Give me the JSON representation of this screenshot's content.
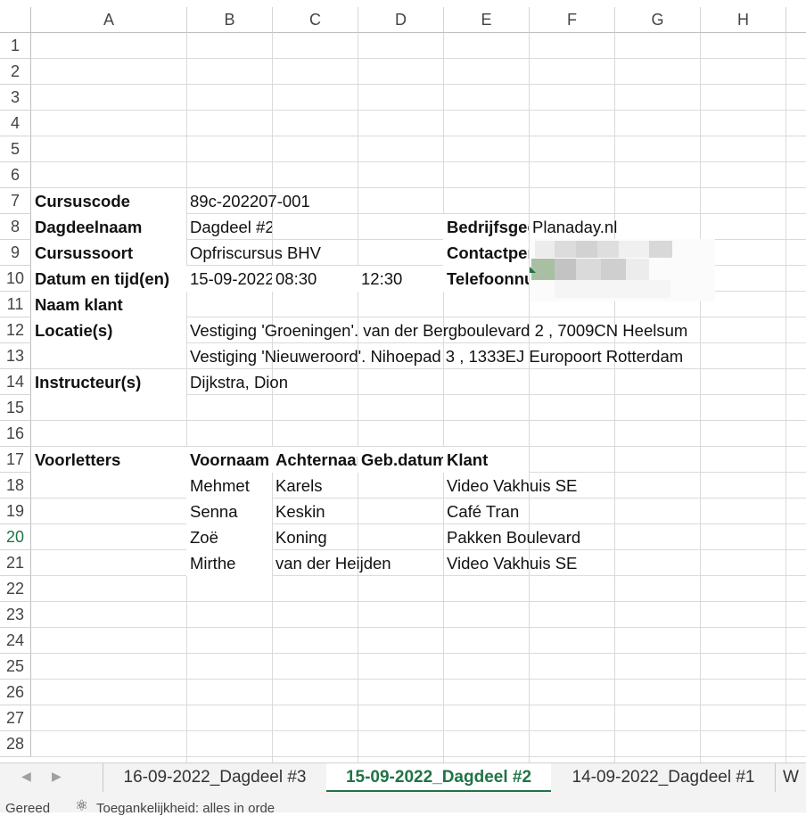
{
  "columns": [
    "A",
    "B",
    "C",
    "D",
    "E",
    "F",
    "G",
    "H"
  ],
  "rows": [
    "1",
    "2",
    "3",
    "4",
    "5",
    "6",
    "7",
    "8",
    "9",
    "10",
    "11",
    "12",
    "13",
    "14",
    "15",
    "16",
    "17",
    "18",
    "19",
    "20",
    "21",
    "22",
    "23",
    "24",
    "25",
    "26",
    "27",
    "28"
  ],
  "active_row": "20",
  "info": {
    "cursuscode_label": "Cursuscode",
    "cursuscode_value": "89c-202207-001",
    "dagdeelnaam_label": "Dagdeelnaam",
    "dagdeelnaam_value": "Dagdeel #2",
    "cursussoort_label": "Cursussoort",
    "cursussoort_value": "Opfriscursus BHV",
    "datum_label": "Datum en tijd(en)",
    "datum_value": "15-09-2022",
    "start_time": "08:30",
    "end_time": "12:30",
    "naam_klant_label": "Naam klant",
    "locatie_label": "Locatie(s)",
    "locatie_1": "Vestiging 'Groeningen'. van der Bergboulevard 2 , 7009CN Heelsum",
    "locatie_2": "Vestiging 'Nieuweroord'. Nihoepad 3 , 1333EJ Europoort Rotterdam",
    "instructeur_label": "Instructeur(s)",
    "instructeur_value": "Dijkstra, Dion",
    "bedrijf_label": "Bedrijfsgegevens",
    "bedrijf_value": "Planaday.nl",
    "contact_label": "Contactpersoon",
    "telefoon_label": "Telefoonnummer"
  },
  "participants": {
    "headers": [
      "Voorletters",
      "Voornaam",
      "Achternaam",
      "Geb.datum",
      "Klant"
    ],
    "rows": [
      {
        "voornaam": "Mehmet",
        "achternaam": "Karels",
        "klant": "Video Vakhuis SE"
      },
      {
        "voornaam": "Senna",
        "achternaam": "Keskin",
        "klant": "Café Tran"
      },
      {
        "voornaam": "Zoë",
        "achternaam": "Koning",
        "klant": "Pakken Boulevard"
      },
      {
        "voornaam": "Mirthe",
        "achternaam": "van der Heijden",
        "klant": "Video Vakhuis SE"
      }
    ]
  },
  "tabs": [
    "16-09-2022_Dagdeel #3",
    "15-09-2022_Dagdeel #2",
    "14-09-2022_Dagdeel #1",
    "W"
  ],
  "active_tab": "15-09-2022_Dagdeel #2",
  "status": {
    "ready": "Gereed",
    "accessibility": "Toegankelijkheid: alles in orde"
  },
  "colors": {
    "accent": "#217346",
    "gridline": "#dadada"
  }
}
